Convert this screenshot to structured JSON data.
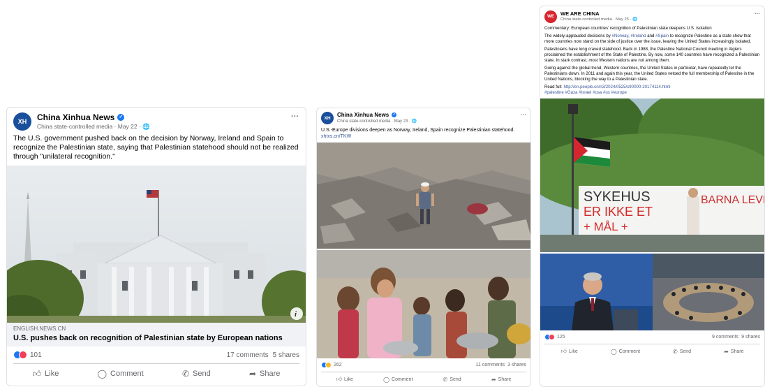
{
  "post1": {
    "author": "China Xinhua News",
    "sub": "China state-controlled media · May 22 · 🌐",
    "body": "The U.S. government pushed back on the decision by Norway, Ireland and Spain to recognize the Palestinian state, saying that Palestinian statehood should not be realized through \"unilateral recognition.\"",
    "link_domain": "ENGLISH.NEWS.CN",
    "link_title": "U.S. pushes back on recognition of Palestinian state by European nations",
    "reactions": "101",
    "comments": "17 comments",
    "shares": "5 shares",
    "avatar_text": "XH",
    "more": "···",
    "actions": {
      "like": "Like",
      "comment": "Comment",
      "send": "Send",
      "share": "Share"
    }
  },
  "post2": {
    "author": "China Xinhua News",
    "sub": "China state-controlled media · May 23 · 🌐",
    "body": "U.S.-Europe divisions deepen as Norway, Ireland, Spain recognize Palestinian statehood.",
    "link": "xhtxs.cn/TKW",
    "reactions": "262",
    "comments": "11 comments",
    "shares": "3 shares",
    "avatar_text": "XH",
    "more": "···",
    "actions": {
      "like": "Like",
      "comment": "Comment",
      "send": "Send",
      "share": "Share"
    }
  },
  "post3": {
    "author": "WE ARE CHINA",
    "sub": "China state-controlled media · May 25 · 🌐",
    "headline": "Commentary: European countries' recognition of Palestinian state deepens U.S. isolation",
    "p1_pre": "The widely-applauded decisions by ",
    "p1_tag1": "#Norway",
    "p1_mid1": ", ",
    "p1_tag2": "#Ireland",
    "p1_mid2": " and ",
    "p1_tag3": "#Spain",
    "p1_post": " to recognize Palestine as a state show that more countries now stand on the side of justice over the issue, leaving the United States increasingly isolated.",
    "p2": "Palestinians have long craved statehood. Back in 1988, the Palestine National Council meeting in Algiers proclaimed the establishment of the State of Palestine. By now, some 140 countries have recognized a Palestinian state. In stark contrast, most Western nations are not among them.",
    "p3": "Going against the global trend, Western countries, the United States in particular, have repeatedly let the Palestinians down. In 2011 and again this year, the United States vetoed the full membership of Palestine in the United Nations, blocking the way to a Palestinian state.",
    "read_label": "Read full: ",
    "read_url": "http://en.people.cn/n3/2024/0525/c90000-20174114.html",
    "hashtags": "#palestine #Gaza #Israel #usa #us #europe",
    "banner_line1": "SYKEHUS",
    "banner_line2": "ER IKKE ET",
    "banner_line3": "+ MÅL  +",
    "banner2": "BARNA LEVE",
    "reactions": "125",
    "comments": "9 comments",
    "shares": "9 shares",
    "avatar_text": "WE",
    "more": "···",
    "actions": {
      "like": "Like",
      "comment": "Comment",
      "send": "Send",
      "share": "Share"
    }
  },
  "colors": {
    "facebook_blue": "#1877f2",
    "like_blue": "#1877f2",
    "love_red": "#f33e58",
    "link": "#385898"
  }
}
